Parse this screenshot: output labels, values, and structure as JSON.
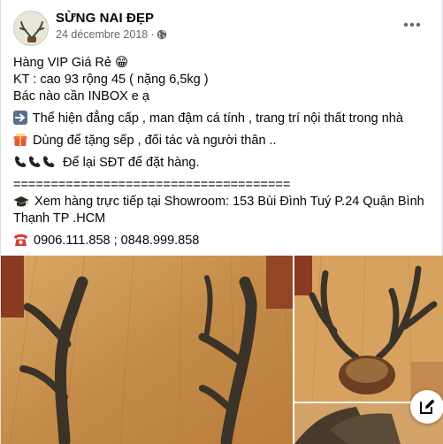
{
  "post": {
    "page_name": "SỪNG NAI ĐẸP",
    "date": "24 décembre 2018",
    "dot": "·",
    "privacy_icon": "globe-icon",
    "more_icon": "more-horizontal-icon"
  },
  "body": {
    "line1_text": "Hàng VIP Giá Rẻ",
    "line1_emoji": "😁",
    "line2": "KT : cao 93 rộng 45 ( nặng 6,5kg )",
    "line3": "Bác nào cần INBOX e ạ",
    "line4": "Thể hiện đẳng cấp , man đậm cá tính , trang trí nội thất trong nhà",
    "line4_icon": "right-arrow-icon",
    "line5": "Dùng để tặng sếp , đối tác và người thân ..",
    "line5_icon": "gift-icon",
    "line6": "Để lại SĐT để đặt hàng.",
    "line6_icon": "phone-receiver-icon",
    "divider": "=====================================",
    "line7": "Xem hàng trực tiếp tại Showroom: 153 Bùi Đình Tuý P.24 Quận Bình",
    "line7_icon": "graduation-cap-icon",
    "line8": "Thạnh TP .HCM",
    "line9": "0906.111.858 ; 0848.999.858",
    "line9_icon": "telephone-icon"
  },
  "colors": {
    "text": "#050505",
    "secondary": "#65676b",
    "wood_floor": "#c9944f",
    "antler": "#3b3328",
    "wood_dark": "#8a3b1f"
  },
  "photos": {
    "count": 3,
    "compose_icon": "edit-compose-icon"
  }
}
